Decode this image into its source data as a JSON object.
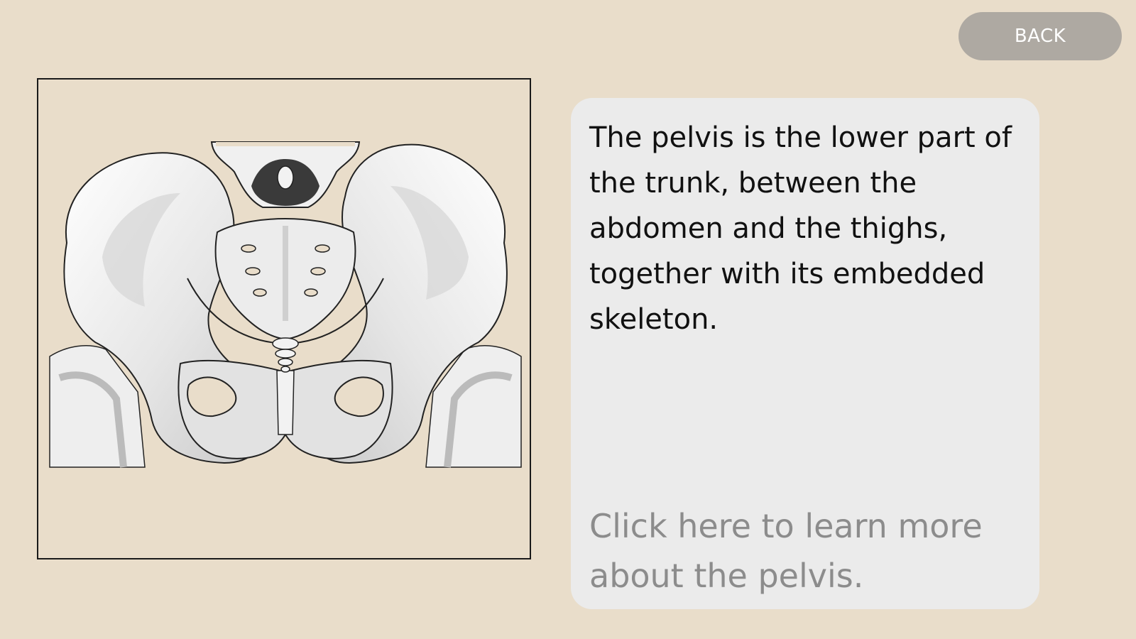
{
  "header": {
    "back_label": "BACK"
  },
  "illustration": {
    "subject": "pelvis skeleton anterior view"
  },
  "info": {
    "description": "The pelvis is the lower part of the trunk, between the abdomen and the thighs, together with its embedded skeleton.",
    "learn_more": "Click here to learn more about the pelvis."
  },
  "colors": {
    "background": "#e9ddca",
    "card": "#ebebeb",
    "back_button": "#aea9a2",
    "link_text": "#8c8c8c"
  }
}
